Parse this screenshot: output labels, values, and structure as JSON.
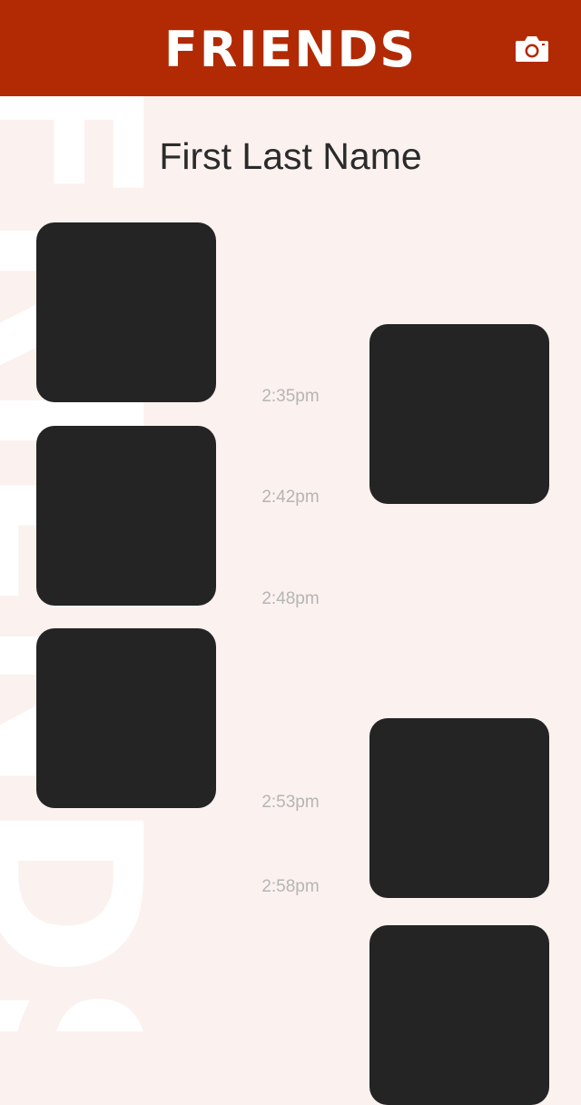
{
  "header": {
    "title": "FRIENDS",
    "background_color": "#b12a03",
    "camera_icon": "camera-icon"
  },
  "background_watermark": "FRIENDS",
  "profile": {
    "name": "First Last Name"
  },
  "timeline": {
    "photos": [
      {
        "side": "left"
      },
      {
        "side": "right"
      },
      {
        "side": "left"
      },
      {
        "side": "left"
      },
      {
        "side": "right"
      },
      {
        "side": "right"
      }
    ],
    "timestamps": [
      "2:35pm",
      "2:42pm",
      "2:48pm",
      "2:53pm",
      "2:58pm"
    ]
  },
  "colors": {
    "accent": "#b12a03",
    "page_background": "#fbf1ef",
    "photo_placeholder": "#242424",
    "timestamp_text": "#b5b5b5"
  }
}
